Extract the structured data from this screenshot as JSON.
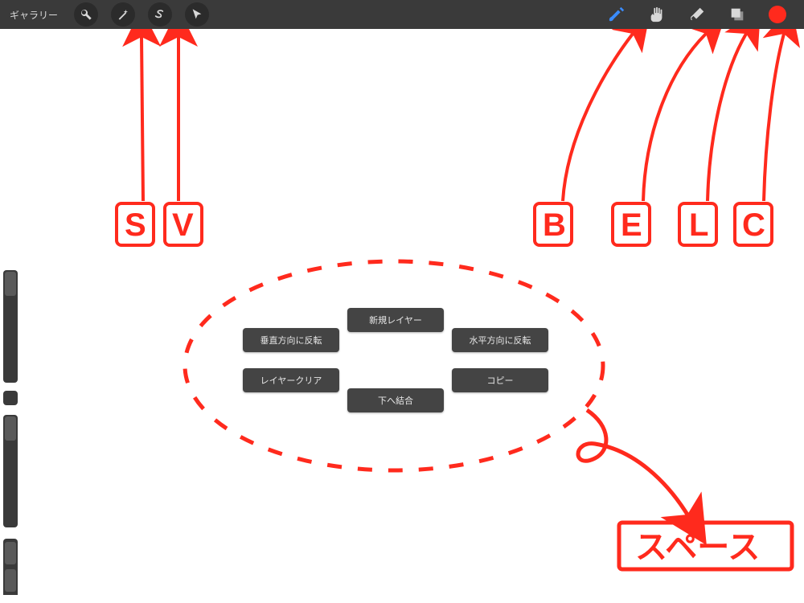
{
  "toolbar": {
    "gallery_label": "ギャラリー",
    "color": "#ff2a1d"
  },
  "quick_menu": {
    "top": "新規レイヤー",
    "bottom": "下へ結合",
    "left_upper": "垂直方向に反転",
    "left_lower": "レイヤークリア",
    "right_upper": "水平方向に反転",
    "right_lower": "コピー"
  },
  "annotations": {
    "s_label": "S",
    "v_label": "V",
    "b_label": "B",
    "e_label": "E",
    "l_label": "L",
    "c_label": "C",
    "space_label": "スペース",
    "color": "#ff2a1d"
  }
}
